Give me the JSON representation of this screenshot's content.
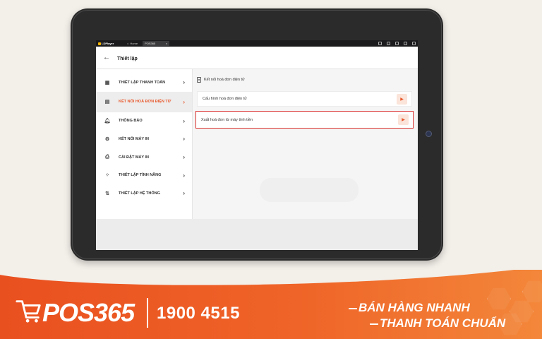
{
  "emulator": {
    "app_name": "LDPlayer",
    "tabs": [
      {
        "label": "Home"
      },
      {
        "label": "POS365"
      }
    ]
  },
  "header": {
    "back_icon": "arrow-left-icon",
    "title": "Thiết lập"
  },
  "sidebar": {
    "items": [
      {
        "icon": "grid-icon",
        "label": "THIẾT LẬP THANH TOÁN",
        "active": false
      },
      {
        "icon": "document-icon",
        "label": "KẾT NỐI HOÁ ĐƠN ĐIỆN TỬ",
        "active": true
      },
      {
        "icon": "bell-icon",
        "label": "THÔNG BÁO",
        "active": false
      },
      {
        "icon": "gear-icon",
        "label": "KẾT NỐI MÁY IN",
        "active": false
      },
      {
        "icon": "printer-icon",
        "label": "CÀI ĐẶT MÁY IN",
        "active": false
      },
      {
        "icon": "features-icon",
        "label": "THIẾT LẬP TÍNH NĂNG",
        "active": false
      },
      {
        "icon": "sliders-icon",
        "label": "THIẾT LẬP HỆ THỐNG",
        "active": false
      }
    ]
  },
  "main": {
    "section_title": "Kết nối hoá đơn điện tử",
    "rows": [
      {
        "label": "Cấu hình hoá đơn điện tử",
        "highlighted": false
      },
      {
        "label": "Xuất hoá đơn từ máy tính tiền",
        "highlighted": true
      }
    ]
  },
  "banner": {
    "brand": "POS365",
    "phone": "1900 4515",
    "slogan_line1": "BÁN HÀNG NHANH",
    "slogan_line2": "THANH TOÁN CHUẨN"
  },
  "colors": {
    "accent": "#e8582b",
    "highlight_border": "#d9302e",
    "banner_orange": "#ef6428"
  }
}
